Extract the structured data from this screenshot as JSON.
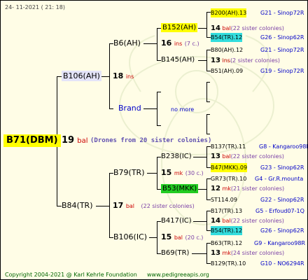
{
  "header": {
    "date": "24- 11-2021 ( 21: 18)"
  },
  "root": {
    "label": "B71(DBM)"
  },
  "gen1": {
    "number": "19",
    "sub": "bal",
    "drones_note": "(Drones from 20 sister colonies)",
    "father": {
      "label": "B106(AH)"
    },
    "mother": {
      "label": "B84(TR)"
    }
  },
  "father_side": {
    "node_number": "18",
    "node_sub": "ins",
    "upper": {
      "label": "B6(AH)",
      "number": "16",
      "sub": "ins",
      "note": "(7 c.)",
      "a": {
        "label": "B152(AH)"
      },
      "b": {
        "label": "B145(AH)"
      }
    },
    "lower": {
      "label": "Brand",
      "no_more": "no more"
    }
  },
  "mother_side": {
    "node_number": "17",
    "node_sub": "bal",
    "node_note": "(22 sister colonies)",
    "upper": {
      "label": "B79(TR)",
      "number": "15",
      "sub": "mk",
      "note": "(30 c.)",
      "a": {
        "label": "B238(IC)"
      },
      "b": {
        "label": "B53(MKK)"
      }
    },
    "lower": {
      "label": "B106(IC)",
      "number": "15",
      "sub": "bal",
      "note": "(20 c.)",
      "a": {
        "label": "B417(IC)"
      },
      "b": {
        "label": "B69(TR)"
      }
    }
  },
  "right": [
    {
      "group": [
        {
          "kind": "entry",
          "name": "B200(AH).13",
          "code": "G21 - Sinop72R",
          "hl": "yellow"
        },
        {
          "kind": "note",
          "num": "14",
          "sub": "bal",
          "text": "(22 sister colonies)"
        },
        {
          "kind": "entry",
          "name": "B54(TR).12",
          "code": "G26 - Sinop62R",
          "hl": "cyan"
        }
      ]
    },
    {
      "group": [
        {
          "kind": "entry",
          "name": "B80(AH).12",
          "code": "G21 - Sinop72R",
          "hl": ""
        },
        {
          "kind": "note",
          "num": "13",
          "sub": "ins",
          "text": "(2 sister colonies)"
        },
        {
          "kind": "entry",
          "name": "B51(AH).09",
          "code": "G19 - Sinop72R",
          "hl": ""
        }
      ]
    },
    {
      "group": [
        {
          "kind": "entry",
          "name": "B137(TR).11",
          "code": "G8 - Kangaroo98R",
          "hl": ""
        },
        {
          "kind": "note",
          "num": "13",
          "sub": "bal",
          "text": "(22 sister colonies)"
        },
        {
          "kind": "entry",
          "name": "B47(MKK).09",
          "code": "G23 - Sinop62R",
          "hl": "yellow"
        }
      ]
    },
    {
      "group": [
        {
          "kind": "entry",
          "name": "GR73(TR).10",
          "code": "G4 - Gr.R.mounta",
          "hl": ""
        },
        {
          "kind": "note",
          "num": "12",
          "sub": "mk",
          "text": "(21 sister colonies)"
        },
        {
          "kind": "entry",
          "name": "ST114.09",
          "code": "G22 - Sinop62R",
          "hl": ""
        }
      ]
    },
    {
      "group": [
        {
          "kind": "entry",
          "name": "B17(TR).13",
          "code": "G5 - Erfoud07-1Q",
          "hl": ""
        },
        {
          "kind": "note",
          "num": "14",
          "sub": "bal",
          "text": "(22 sister colonies)"
        },
        {
          "kind": "entry",
          "name": "B54(TR).12",
          "code": "G26 - Sinop62R",
          "hl": "cyan"
        }
      ]
    },
    {
      "group": [
        {
          "kind": "entry",
          "name": "B63(TR).12",
          "code": "G9 - Kangaroo98R",
          "hl": ""
        },
        {
          "kind": "note",
          "num": "13",
          "sub": "mk",
          "text": "(24 sister colonies)"
        },
        {
          "kind": "entry",
          "name": "B129(TR).10",
          "code": "G10 - NO6294R",
          "hl": ""
        }
      ]
    }
  ],
  "footer": {
    "copyright": "Copyright 2004-2021 @ Karl Kehrle Foundation",
    "site": "www.pedigreeapis.org"
  },
  "colors": {
    "background": "#fffde6",
    "highlight_yellow": "#ffff00",
    "highlight_cyan": "#33dddd",
    "highlight_green": "#22cc22",
    "link_blue": "#0000c8",
    "footer_green": "#006600"
  }
}
